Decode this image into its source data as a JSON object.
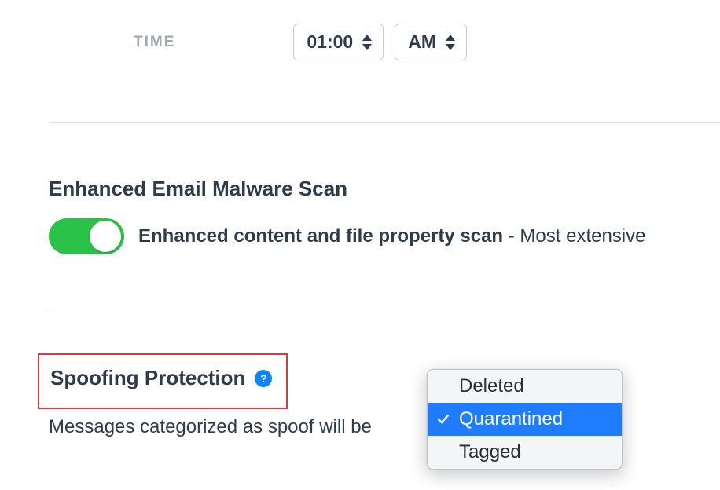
{
  "time": {
    "label": "TIME",
    "value": "01:00",
    "meridiem": "AM"
  },
  "malware": {
    "title": "Enhanced Email Malware Scan",
    "toggle_on": true,
    "main_text": "Enhanced content and file property scan",
    "suffix_text": " - Most extensive"
  },
  "spoofing": {
    "title": "Spoofing Protection",
    "help_icon": "?",
    "description": "Messages categorized as spoof will be",
    "options": {
      "deleted": "Deleted",
      "quarantined": "Quarantined",
      "tagged": "Tagged"
    },
    "selected": "Quarantined"
  }
}
